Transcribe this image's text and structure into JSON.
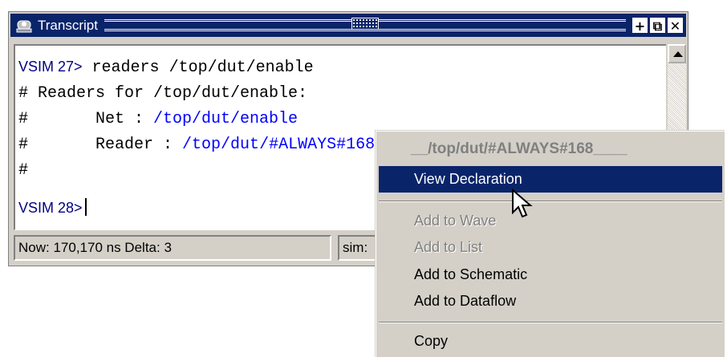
{
  "window": {
    "title": "Transcript",
    "buttons": [
      "+",
      "⧉",
      "✕"
    ]
  },
  "transcript": {
    "line1": {
      "prompt": "VSIM 27>",
      "command": " readers /top/dut/enable"
    },
    "line2": "# Readers for /top/dut/enable:",
    "line3": {
      "prefix": "#       Net : ",
      "value": "/top/dut/enable"
    },
    "line4": {
      "prefix": "#       Reader : ",
      "value": "/top/dut/#ALWAYS#168"
    },
    "line5": "#",
    "line6": {
      "prompt": "VSIM 28>"
    }
  },
  "status": {
    "now": "Now: 170,170 ns  Delta: 3",
    "sim": "sim:"
  },
  "context_menu": {
    "header": "__/top/dut/#ALWAYS#168____",
    "items": {
      "view_declaration": "View Declaration",
      "add_to_wave": "Add to Wave",
      "add_to_list": "Add to List",
      "add_to_schematic": "Add to Schematic",
      "add_to_dataflow": "Add to Dataflow",
      "copy": "Copy"
    }
  },
  "colors": {
    "titlebar": "#0a246a",
    "selection": "#0a246a",
    "link": "#0000ff",
    "prompt": "#000080",
    "chrome": "#d4d0c8"
  }
}
